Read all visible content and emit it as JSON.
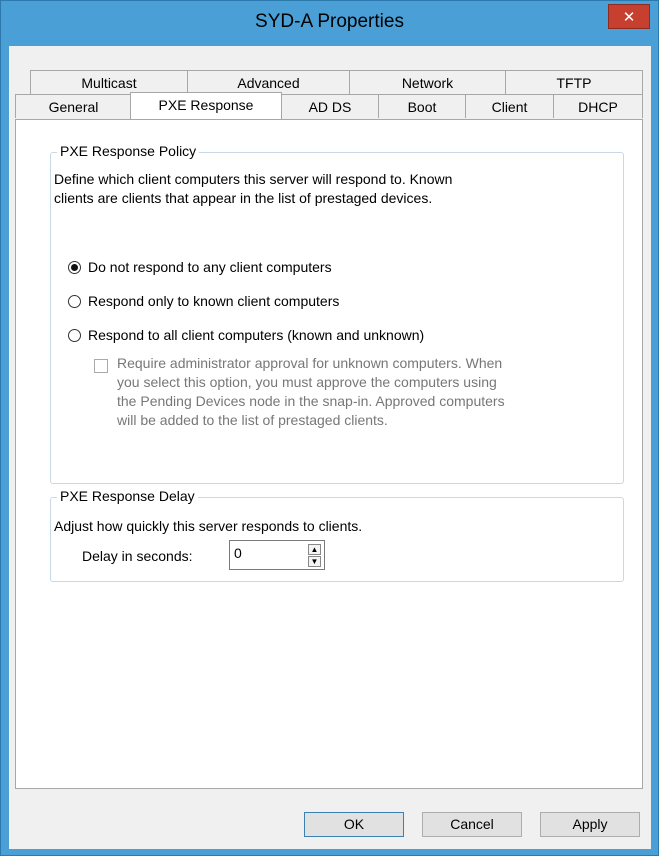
{
  "window": {
    "title": "SYD-A Properties"
  },
  "tabs": {
    "row1": [
      "Multicast",
      "Advanced",
      "Network",
      "TFTP"
    ],
    "row2": [
      "General",
      "PXE Response",
      "AD DS",
      "Boot",
      "Client",
      "DHCP"
    ],
    "active": "PXE Response"
  },
  "policy": {
    "title": "PXE Response Policy",
    "description_line1": "Define which client computers this server will respond to. Known",
    "description_line2": "clients are clients that appear in the list of prestaged devices.",
    "options": [
      {
        "label": "Do not respond to any client computers",
        "checked": true
      },
      {
        "label": "Respond only to known client computers",
        "checked": false
      },
      {
        "label": "Respond to all client computers (known and unknown)",
        "checked": false
      }
    ],
    "approval": {
      "checked": false,
      "enabled": false,
      "line1": "Require administrator approval for unknown computers. When",
      "line2": "you select this option, you must approve the computers using",
      "line3": "the Pending Devices node in the snap-in. Approved computers",
      "line4": "will be added to the list of prestaged clients."
    }
  },
  "delay": {
    "title": "PXE Response Delay",
    "description": "Adjust how quickly this server responds to clients.",
    "label": "Delay in seconds:",
    "value": "0"
  },
  "buttons": {
    "ok": "OK",
    "cancel": "Cancel",
    "apply": "Apply"
  }
}
